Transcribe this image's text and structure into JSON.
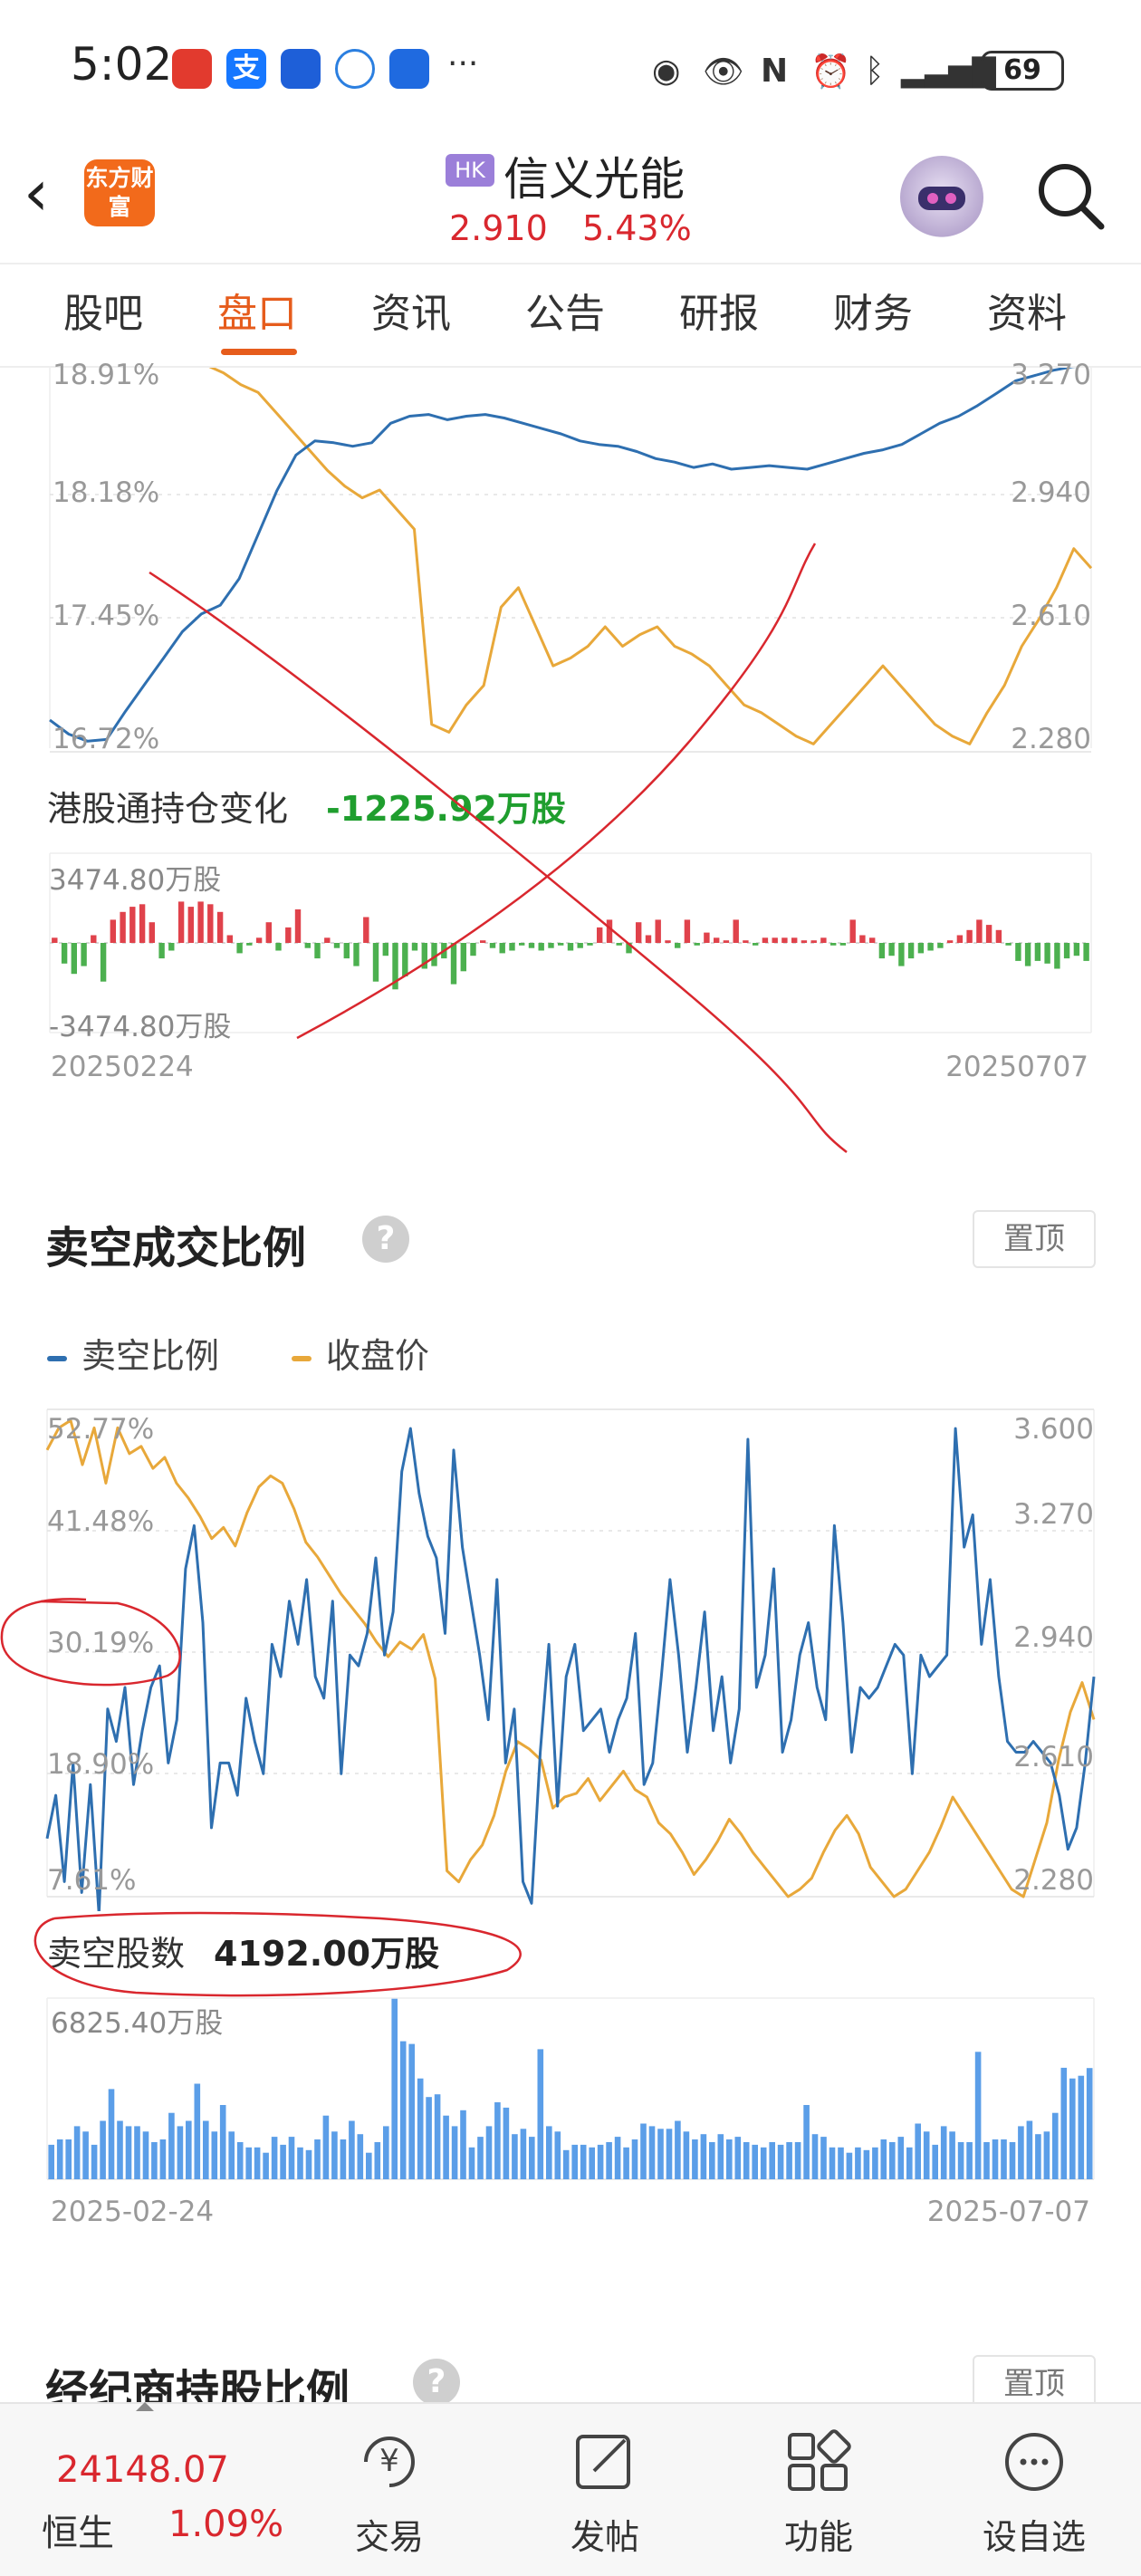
{
  "status_bar": {
    "time": "5:02",
    "battery": "69",
    "more": "···"
  },
  "header": {
    "logo_text": "东方财富",
    "exchange_badge": "HK",
    "stock_name": "信义光能",
    "price": "2.910",
    "change_pct": "5.43%"
  },
  "tabs": [
    "股吧",
    "盘口",
    "资讯",
    "公告",
    "研报",
    "财务",
    "资料"
  ],
  "active_tab": 1,
  "top_chart": {
    "left_ticks": [
      "18.91%",
      "18.18%",
      "17.45%",
      "16.72%"
    ],
    "right_ticks": [
      "3.270",
      "2.940",
      "2.610",
      "2.280"
    ],
    "chart_data": {
      "type": "line",
      "series": [
        {
          "color": "#2e6fb0",
          "values": [
            16.9,
            16.82,
            16.78,
            16.79,
            16.95,
            17.1,
            17.25,
            17.4,
            17.5,
            17.55,
            17.7,
            17.95,
            18.2,
            18.4,
            18.48,
            18.47,
            18.45,
            18.47,
            18.58,
            18.62,
            18.63,
            18.6,
            18.62,
            18.63,
            18.61,
            18.58,
            18.55,
            18.52,
            18.48,
            18.46,
            18.45,
            18.42,
            18.38,
            18.36,
            18.33,
            18.35,
            18.32,
            18.33,
            18.34,
            18.33,
            18.32,
            18.35,
            18.38,
            18.41,
            18.43,
            18.46,
            18.52,
            18.58,
            18.62,
            18.68,
            18.75,
            18.82,
            18.85,
            18.88,
            18.9,
            18.91
          ]
        },
        {
          "color": "#e8a83a",
          "values": [
            3.35,
            3.34,
            3.32,
            3.31,
            3.32,
            3.33,
            3.3,
            3.31,
            3.28,
            3.27,
            3.25,
            3.22,
            3.2,
            3.15,
            3.1,
            3.05,
            3.0,
            2.96,
            2.93,
            2.95,
            2.9,
            2.85,
            2.35,
            2.33,
            2.4,
            2.45,
            2.65,
            2.7,
            2.6,
            2.5,
            2.52,
            2.55,
            2.6,
            2.55,
            2.58,
            2.6,
            2.55,
            2.53,
            2.5,
            2.45,
            2.4,
            2.38,
            2.35,
            2.32,
            2.3,
            2.35,
            2.4,
            2.45,
            2.5,
            2.45,
            2.4,
            2.35,
            2.32,
            2.3,
            2.38,
            2.45,
            2.55,
            2.62,
            2.7,
            2.8,
            2.75
          ]
        }
      ],
      "ylim_left": [
        16.72,
        18.91
      ],
      "ylim_right": [
        2.28,
        3.27
      ]
    }
  },
  "flow_chart": {
    "label": "港股通持仓变化",
    "value": "-1225.92万股",
    "max_label": "3474.80万股",
    "min_label": "-3474.80万股",
    "start_date": "20250224",
    "end_date": "20250707",
    "chart_data": {
      "type": "bar",
      "values": [
        200,
        -800,
        -1200,
        -900,
        300,
        -1500,
        900,
        1200,
        1400,
        1500,
        800,
        -600,
        -300,
        1600,
        1400,
        1600,
        1500,
        1200,
        300,
        -400,
        -100,
        200,
        800,
        -300,
        600,
        1300,
        -200,
        -600,
        200,
        -200,
        -600,
        -900,
        1000,
        -1500,
        -500,
        -1800,
        -1300,
        -300,
        -1000,
        -900,
        -600,
        -1600,
        -1100,
        -500,
        100,
        -200,
        -400,
        -300,
        -100,
        -200,
        -300,
        -200,
        -100,
        -300,
        -200,
        -100,
        600,
        900,
        -100,
        -400,
        800,
        300,
        900,
        100,
        -200,
        900,
        -100,
        400,
        200,
        100,
        900,
        100,
        -100,
        200,
        200,
        200,
        200,
        100,
        100,
        200,
        -100,
        -100,
        900,
        300,
        200,
        -600,
        -500,
        -900,
        -600,
        -400,
        -300,
        -200,
        100,
        300,
        500,
        900,
        700,
        500,
        -100,
        -700,
        -900,
        -700,
        -800,
        -1000,
        -600,
        -500,
        -700
      ]
    }
  },
  "short_section": {
    "title": "卖空成交比例",
    "help": "?",
    "pin": "置顶",
    "legend": [
      {
        "label": "卖空比例",
        "color": "#2e6fb0"
      },
      {
        "label": "收盘价",
        "color": "#e8a83a"
      }
    ],
    "left_ticks": [
      "52.77%",
      "41.48%",
      "30.19%",
      "18.90%",
      "7.61%"
    ],
    "right_ticks": [
      "3.600",
      "3.270",
      "2.940",
      "2.610",
      "2.280"
    ],
    "chart_data": {
      "type": "line",
      "series": [
        {
          "name": "卖空比例",
          "color": "#2e6fb0",
          "values": [
            13,
            17,
            9,
            20,
            8,
            18,
            6,
            25,
            22,
            27,
            18,
            23,
            27,
            29,
            20,
            24,
            38,
            42,
            33,
            14,
            20,
            20,
            17,
            26,
            22,
            19,
            31,
            28,
            35,
            31,
            37,
            28,
            26,
            35,
            19,
            30,
            29,
            32,
            39,
            30,
            34,
            47,
            51,
            45,
            41,
            39,
            32,
            49,
            40,
            35,
            30,
            24,
            37,
            20,
            25,
            9,
            7,
            21,
            31,
            16,
            28,
            31,
            23,
            24,
            25,
            21,
            24,
            26,
            32,
            18,
            20,
            28,
            37,
            30,
            21,
            27,
            34,
            23,
            28,
            20,
            25,
            50,
            27,
            30,
            38,
            21,
            24,
            30,
            33,
            27,
            24,
            42,
            33,
            21,
            27,
            26,
            27,
            29,
            31,
            30,
            19,
            30,
            28,
            29,
            30,
            51,
            40,
            43,
            31,
            37,
            28,
            22,
            21,
            21,
            22,
            21,
            20,
            17,
            12,
            14,
            20,
            28
          ]
        },
        {
          "name": "收盘价",
          "color": "#e8a83a",
          "values": [
            3.49,
            3.55,
            3.57,
            3.45,
            3.55,
            3.4,
            3.55,
            3.48,
            3.5,
            3.44,
            3.47,
            3.4,
            3.36,
            3.31,
            3.25,
            3.28,
            3.23,
            3.32,
            3.39,
            3.42,
            3.4,
            3.33,
            3.24,
            3.2,
            3.15,
            3.1,
            3.06,
            3.02,
            2.97,
            2.93,
            2.97,
            2.95,
            2.99,
            2.87,
            2.35,
            2.32,
            2.38,
            2.42,
            2.5,
            2.62,
            2.7,
            2.68,
            2.65,
            2.52,
            2.55,
            2.56,
            2.6,
            2.54,
            2.58,
            2.62,
            2.57,
            2.55,
            2.48,
            2.45,
            2.4,
            2.34,
            2.38,
            2.43,
            2.49,
            2.45,
            2.4,
            2.36,
            2.32,
            2.28,
            2.3,
            2.33,
            2.4,
            2.46,
            2.5,
            2.45,
            2.36,
            2.32,
            2.28,
            2.3,
            2.35,
            2.4,
            2.47,
            2.55,
            2.5,
            2.45,
            2.4,
            2.35,
            2.3,
            2.28,
            2.38,
            2.48,
            2.65,
            2.78,
            2.86,
            2.76
          ]
        }
      ],
      "ylim_left": [
        7.61,
        52.77
      ],
      "ylim_right": [
        2.28,
        3.6
      ]
    }
  },
  "short_volume": {
    "label": "卖空股数",
    "value": "4192.00万股",
    "max_label": "6825.40万股",
    "start_date": "2025-02-24",
    "end_date": "2025-07-07",
    "chart_data": {
      "type": "bar",
      "values": [
        1300,
        1500,
        1500,
        2000,
        1800,
        1300,
        2200,
        3400,
        2200,
        2000,
        2000,
        1800,
        1400,
        1500,
        2500,
        2000,
        2200,
        3600,
        2200,
        1800,
        2800,
        1800,
        1400,
        1200,
        1200,
        1000,
        1600,
        1300,
        1600,
        1200,
        1100,
        1500,
        2400,
        1800,
        1500,
        2200,
        1700,
        1000,
        1400,
        2000,
        6800,
        5200,
        5100,
        3800,
        3100,
        3200,
        2400,
        2000,
        2600,
        1200,
        1600,
        2000,
        2900,
        2700,
        1700,
        1900,
        1600,
        4900,
        2000,
        1800,
        1100,
        1300,
        1300,
        1200,
        1300,
        1400,
        1600,
        1200,
        1500,
        2100,
        2000,
        1900,
        1900,
        2200,
        1800,
        1500,
        1700,
        1400,
        1700,
        1500,
        1600,
        1400,
        1300,
        1200,
        1400,
        1300,
        1400,
        1400,
        2800,
        1700,
        1600,
        1200,
        1200,
        1000,
        1200,
        1100,
        1200,
        1500,
        1400,
        1600,
        1200,
        2100,
        1800,
        1300,
        2000,
        1800,
        1400,
        1400,
        4800,
        1400,
        1500,
        1500,
        1400,
        2000,
        2200,
        1700,
        1800,
        2500,
        4200,
        3800,
        3900,
        4192
      ]
    }
  },
  "next_section": {
    "title": "经纪商持股比例",
    "help": "?",
    "pin": "置顶"
  },
  "bottom_bar": {
    "index_value": "24148.07",
    "index_name": "恒生",
    "index_change": "1.09%",
    "items": [
      "交易",
      "发帖",
      "功能",
      "设自选"
    ],
    "trade_icon_text": "¥"
  }
}
